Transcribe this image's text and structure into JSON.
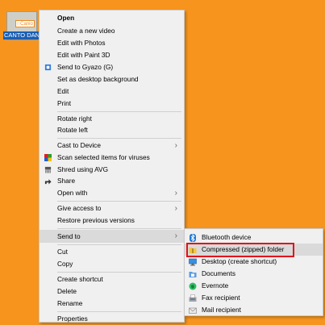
{
  "desktop_icon": {
    "thumb_text": "Canio",
    "name": "CANTO DAN"
  },
  "context_menu": {
    "items": [
      {
        "label": "Open"
      },
      {
        "label": "Create a new video"
      },
      {
        "label": "Edit with Photos"
      },
      {
        "label": "Edit with Paint 3D"
      },
      {
        "label": "Send to Gyazo (G)"
      },
      {
        "label": "Set as desktop background"
      },
      {
        "label": "Edit"
      },
      {
        "label": "Print"
      },
      {
        "label": "Rotate right"
      },
      {
        "label": "Rotate left"
      },
      {
        "label": "Cast to Device"
      },
      {
        "label": "Scan selected items for viruses"
      },
      {
        "label": "Shred using AVG"
      },
      {
        "label": "Share"
      },
      {
        "label": "Open with"
      },
      {
        "label": "Give access to"
      },
      {
        "label": "Restore previous versions"
      },
      {
        "label": "Send to"
      },
      {
        "label": "Cut"
      },
      {
        "label": "Copy"
      },
      {
        "label": "Create shortcut"
      },
      {
        "label": "Delete"
      },
      {
        "label": "Rename"
      },
      {
        "label": "Properties"
      }
    ]
  },
  "sendto_menu": {
    "items": [
      {
        "label": "Bluetooth device"
      },
      {
        "label": "Compressed (zipped) folder"
      },
      {
        "label": "Desktop (create shortcut)"
      },
      {
        "label": "Documents"
      },
      {
        "label": "Evernote"
      },
      {
        "label": "Fax recipient"
      },
      {
        "label": "Mail recipient"
      }
    ]
  },
  "colors": {
    "desktop": "#f7941d",
    "highlight_box": "#e0121b",
    "selection": "#1a5fb4"
  }
}
